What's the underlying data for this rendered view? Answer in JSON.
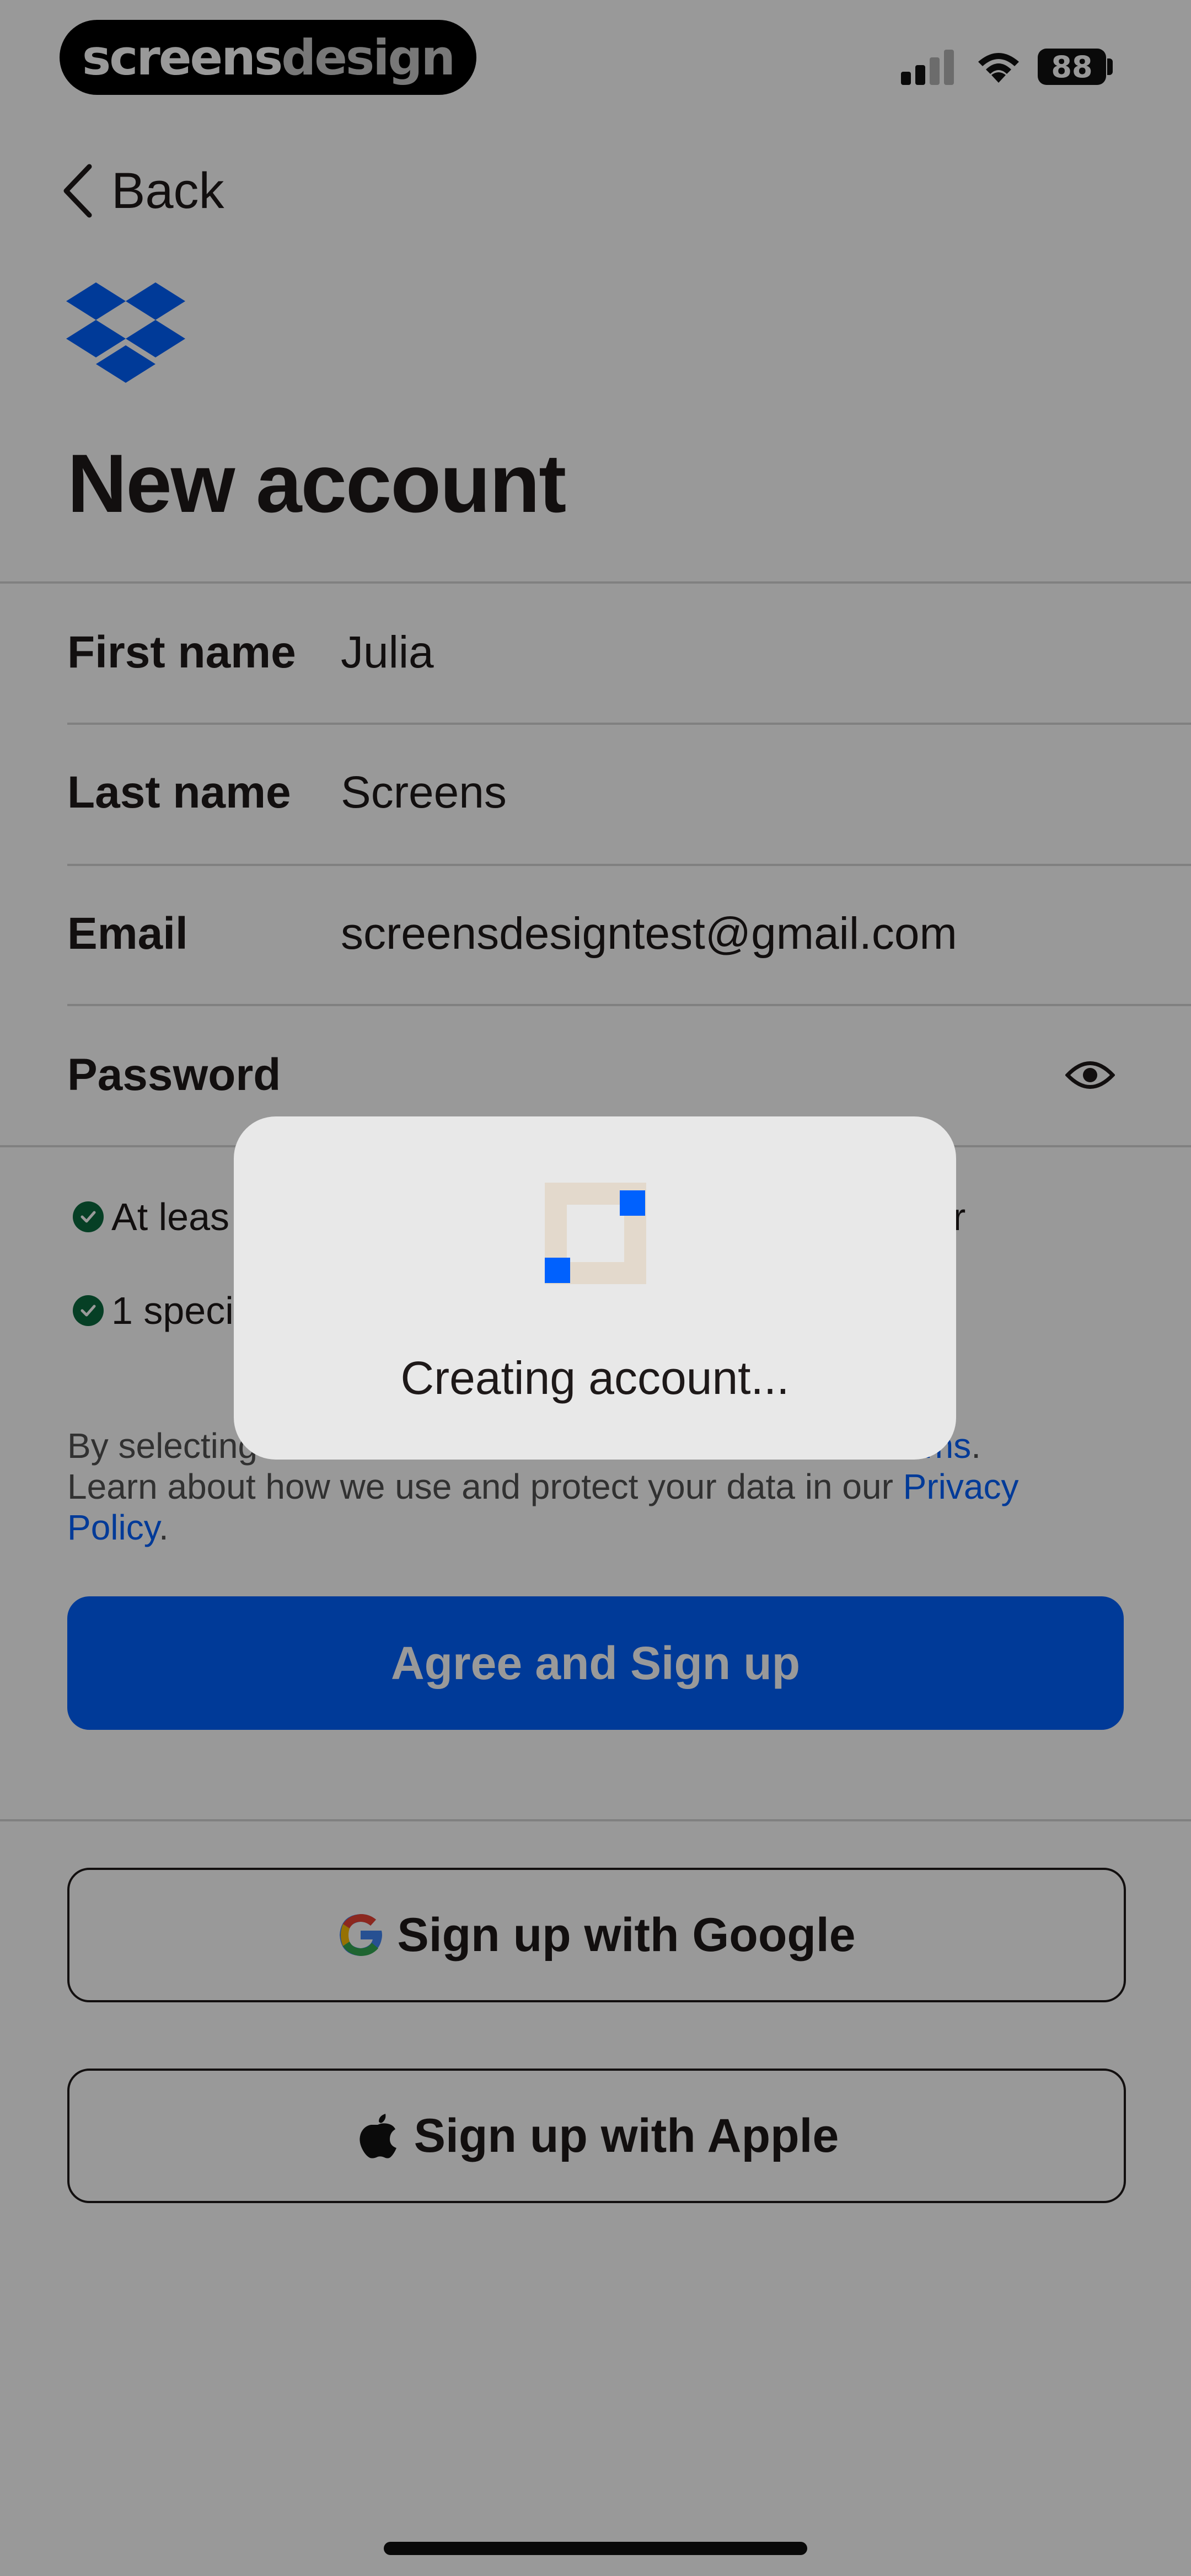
{
  "status_bar": {
    "brand_part1": "screens",
    "brand_part2": "design",
    "battery": "88"
  },
  "nav": {
    "back_label": "Back"
  },
  "page_title": "New account",
  "form": {
    "first_name": {
      "label": "First name",
      "value": "Julia"
    },
    "last_name": {
      "label": "Last name",
      "value": "Screens"
    },
    "email": {
      "label": "Email",
      "value": "screensdesigntest@gmail.com"
    },
    "password": {
      "label": "Password",
      "value": ""
    }
  },
  "requirements": [
    {
      "text": "At leas",
      "met": true
    },
    {
      "text": "r",
      "met": true
    },
    {
      "text": "1 speci",
      "met": true
    }
  ],
  "legal": {
    "prefix": "By selecting",
    "terms_link": "Terms",
    "terms_suffix": ".",
    "line2": "Learn about how we use and protect your data in our",
    "privacy_link": "Privacy Policy",
    "end": "."
  },
  "buttons": {
    "agree_signup": "Agree and Sign up",
    "google": "Sign up with Google",
    "apple": "Sign up with Apple"
  },
  "overlay": {
    "message": "Creating account..."
  },
  "colors": {
    "accent": "#0061fe",
    "text": "#1e1919",
    "success": "#0b6a3f"
  },
  "icons": {
    "back": "chevron-left-icon",
    "logo": "dropbox-logo-icon",
    "password_toggle": "eye-icon",
    "check": "check-circle-icon",
    "google": "google-g-icon",
    "apple": "apple-icon"
  }
}
